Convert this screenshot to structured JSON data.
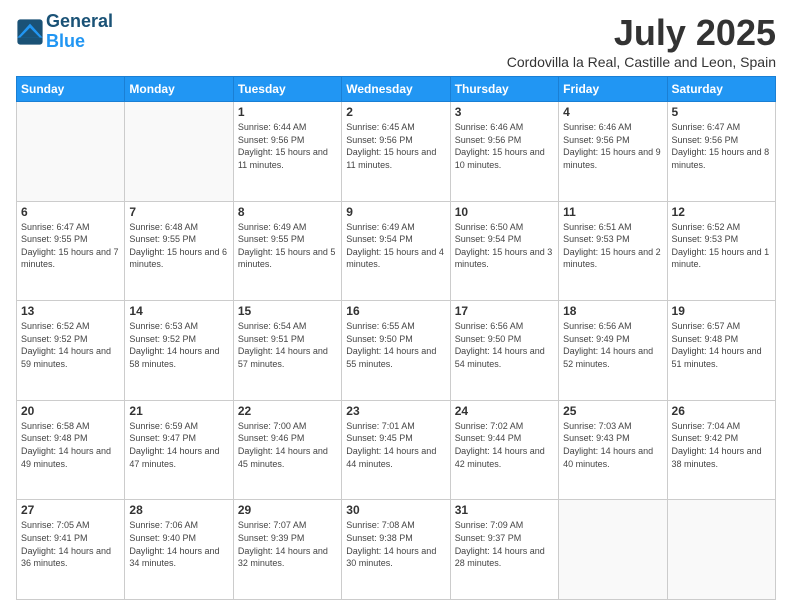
{
  "header": {
    "logo_line1": "General",
    "logo_line2": "Blue",
    "month": "July 2025",
    "location": "Cordovilla la Real, Castille and Leon, Spain"
  },
  "weekdays": [
    "Sunday",
    "Monday",
    "Tuesday",
    "Wednesday",
    "Thursday",
    "Friday",
    "Saturday"
  ],
  "weeks": [
    [
      {
        "day": "",
        "info": ""
      },
      {
        "day": "",
        "info": ""
      },
      {
        "day": "1",
        "info": "Sunrise: 6:44 AM\nSunset: 9:56 PM\nDaylight: 15 hours and 11 minutes."
      },
      {
        "day": "2",
        "info": "Sunrise: 6:45 AM\nSunset: 9:56 PM\nDaylight: 15 hours and 11 minutes."
      },
      {
        "day": "3",
        "info": "Sunrise: 6:46 AM\nSunset: 9:56 PM\nDaylight: 15 hours and 10 minutes."
      },
      {
        "day": "4",
        "info": "Sunrise: 6:46 AM\nSunset: 9:56 PM\nDaylight: 15 hours and 9 minutes."
      },
      {
        "day": "5",
        "info": "Sunrise: 6:47 AM\nSunset: 9:56 PM\nDaylight: 15 hours and 8 minutes."
      }
    ],
    [
      {
        "day": "6",
        "info": "Sunrise: 6:47 AM\nSunset: 9:55 PM\nDaylight: 15 hours and 7 minutes."
      },
      {
        "day": "7",
        "info": "Sunrise: 6:48 AM\nSunset: 9:55 PM\nDaylight: 15 hours and 6 minutes."
      },
      {
        "day": "8",
        "info": "Sunrise: 6:49 AM\nSunset: 9:55 PM\nDaylight: 15 hours and 5 minutes."
      },
      {
        "day": "9",
        "info": "Sunrise: 6:49 AM\nSunset: 9:54 PM\nDaylight: 15 hours and 4 minutes."
      },
      {
        "day": "10",
        "info": "Sunrise: 6:50 AM\nSunset: 9:54 PM\nDaylight: 15 hours and 3 minutes."
      },
      {
        "day": "11",
        "info": "Sunrise: 6:51 AM\nSunset: 9:53 PM\nDaylight: 15 hours and 2 minutes."
      },
      {
        "day": "12",
        "info": "Sunrise: 6:52 AM\nSunset: 9:53 PM\nDaylight: 15 hours and 1 minute."
      }
    ],
    [
      {
        "day": "13",
        "info": "Sunrise: 6:52 AM\nSunset: 9:52 PM\nDaylight: 14 hours and 59 minutes."
      },
      {
        "day": "14",
        "info": "Sunrise: 6:53 AM\nSunset: 9:52 PM\nDaylight: 14 hours and 58 minutes."
      },
      {
        "day": "15",
        "info": "Sunrise: 6:54 AM\nSunset: 9:51 PM\nDaylight: 14 hours and 57 minutes."
      },
      {
        "day": "16",
        "info": "Sunrise: 6:55 AM\nSunset: 9:50 PM\nDaylight: 14 hours and 55 minutes."
      },
      {
        "day": "17",
        "info": "Sunrise: 6:56 AM\nSunset: 9:50 PM\nDaylight: 14 hours and 54 minutes."
      },
      {
        "day": "18",
        "info": "Sunrise: 6:56 AM\nSunset: 9:49 PM\nDaylight: 14 hours and 52 minutes."
      },
      {
        "day": "19",
        "info": "Sunrise: 6:57 AM\nSunset: 9:48 PM\nDaylight: 14 hours and 51 minutes."
      }
    ],
    [
      {
        "day": "20",
        "info": "Sunrise: 6:58 AM\nSunset: 9:48 PM\nDaylight: 14 hours and 49 minutes."
      },
      {
        "day": "21",
        "info": "Sunrise: 6:59 AM\nSunset: 9:47 PM\nDaylight: 14 hours and 47 minutes."
      },
      {
        "day": "22",
        "info": "Sunrise: 7:00 AM\nSunset: 9:46 PM\nDaylight: 14 hours and 45 minutes."
      },
      {
        "day": "23",
        "info": "Sunrise: 7:01 AM\nSunset: 9:45 PM\nDaylight: 14 hours and 44 minutes."
      },
      {
        "day": "24",
        "info": "Sunrise: 7:02 AM\nSunset: 9:44 PM\nDaylight: 14 hours and 42 minutes."
      },
      {
        "day": "25",
        "info": "Sunrise: 7:03 AM\nSunset: 9:43 PM\nDaylight: 14 hours and 40 minutes."
      },
      {
        "day": "26",
        "info": "Sunrise: 7:04 AM\nSunset: 9:42 PM\nDaylight: 14 hours and 38 minutes."
      }
    ],
    [
      {
        "day": "27",
        "info": "Sunrise: 7:05 AM\nSunset: 9:41 PM\nDaylight: 14 hours and 36 minutes."
      },
      {
        "day": "28",
        "info": "Sunrise: 7:06 AM\nSunset: 9:40 PM\nDaylight: 14 hours and 34 minutes."
      },
      {
        "day": "29",
        "info": "Sunrise: 7:07 AM\nSunset: 9:39 PM\nDaylight: 14 hours and 32 minutes."
      },
      {
        "day": "30",
        "info": "Sunrise: 7:08 AM\nSunset: 9:38 PM\nDaylight: 14 hours and 30 minutes."
      },
      {
        "day": "31",
        "info": "Sunrise: 7:09 AM\nSunset: 9:37 PM\nDaylight: 14 hours and 28 minutes."
      },
      {
        "day": "",
        "info": ""
      },
      {
        "day": "",
        "info": ""
      }
    ]
  ]
}
